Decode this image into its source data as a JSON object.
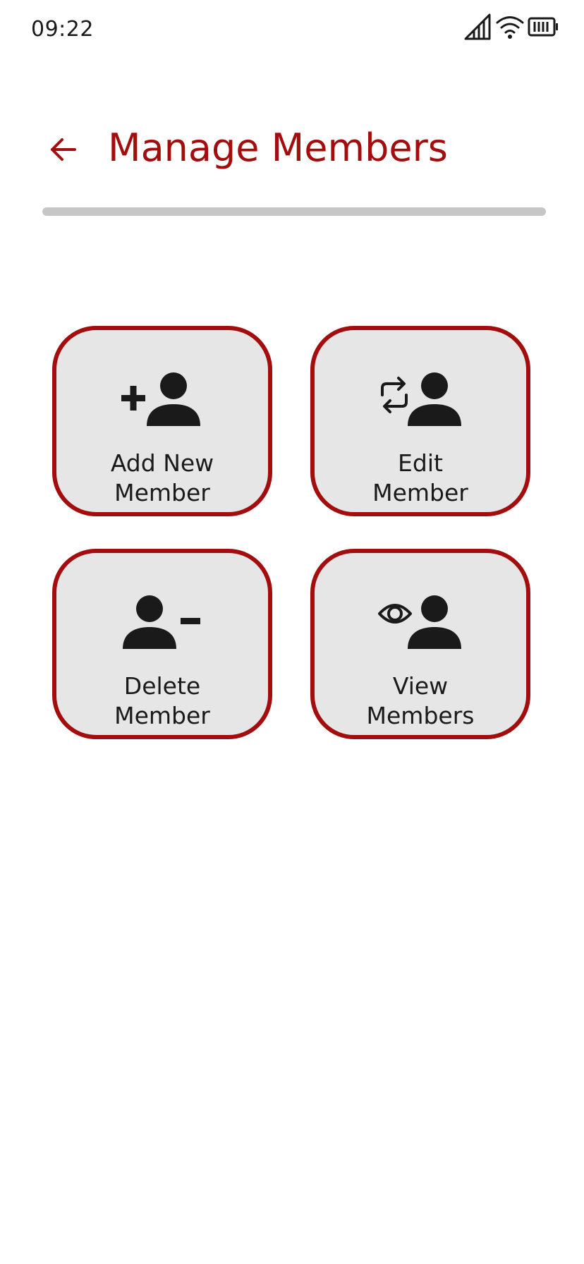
{
  "status_bar": {
    "time": "09:22",
    "icons": [
      "signal-icon",
      "wifi-icon",
      "battery-icon"
    ]
  },
  "header": {
    "back_icon": "arrow-left-icon",
    "title": "Manage Members"
  },
  "colors": {
    "accent": "#a30d0d",
    "tile_background": "#e6e6e6",
    "divider": "#c6c6c6",
    "text": "#1a1a1a"
  },
  "tiles": [
    {
      "icon": "add-person-icon",
      "label_line1": "Add New",
      "label_line2": "Member"
    },
    {
      "icon": "swap-person-icon",
      "label_line1": "Edit",
      "label_line2": "Member"
    },
    {
      "icon": "remove-person-icon",
      "label_line1": "Delete",
      "label_line2": "Member"
    },
    {
      "icon": "view-person-icon",
      "label_line1": "View",
      "label_line2": "Members"
    }
  ]
}
